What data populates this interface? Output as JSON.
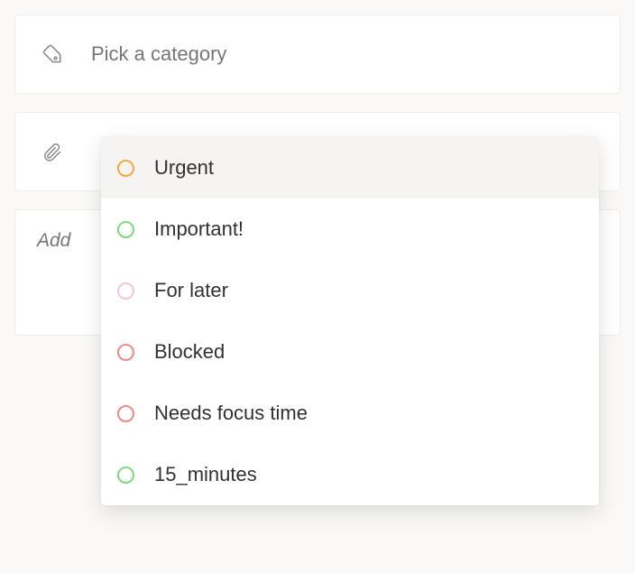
{
  "category": {
    "placeholder": "Pick a category",
    "value": ""
  },
  "note": {
    "placeholder": "Add"
  },
  "dropdown": {
    "items": [
      {
        "label": "Urgent",
        "color": "#f3a93c",
        "highlighted": true
      },
      {
        "label": "Important!",
        "color": "#7fd87f",
        "highlighted": false
      },
      {
        "label": "For later",
        "color": "#f7c6dc",
        "highlighted": false
      },
      {
        "label": "Blocked",
        "color": "#ed8a85",
        "highlighted": false
      },
      {
        "label": "Needs focus time",
        "color": "#ed8a85",
        "highlighted": false
      },
      {
        "label": "15_minutes",
        "color": "#7fd87f",
        "highlighted": false
      }
    ]
  }
}
